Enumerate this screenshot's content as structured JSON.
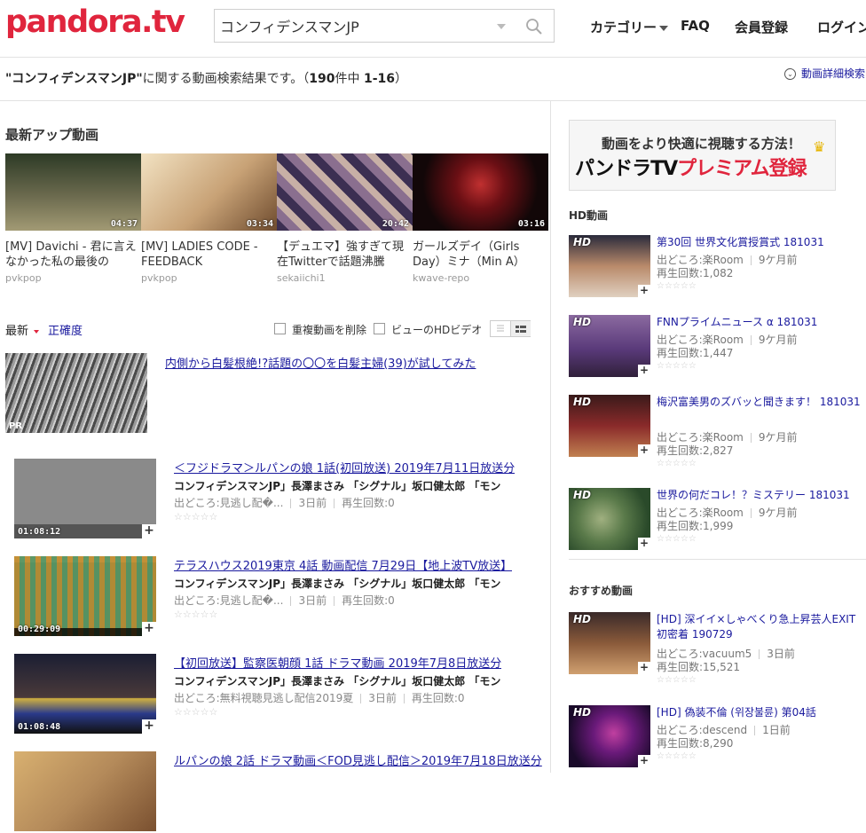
{
  "header": {
    "logo": "pandora.tv",
    "search_value": "コンフィデンスマンJP",
    "nav": [
      "カテゴリー",
      "FAQ",
      "会員登録",
      "ログイン"
    ]
  },
  "result_bar": {
    "query": "\"コンフィデンスマンJP\"",
    "text_mid": "に関する動画検索結果です。（",
    "total": "190",
    "text_unit": "件中 ",
    "range": "1-16",
    "text_end": "）",
    "advanced_search": "動画詳細検索"
  },
  "latest": {
    "title": "最新アップ動画",
    "items": [
      {
        "title": "[MV] Davichi - 君に言えなかった私の最後の",
        "channel": "pvkpop",
        "duration": "04:37",
        "colors": [
          "#2d3a26",
          "#6b6a4e",
          "#a29a74"
        ]
      },
      {
        "title": "[MV] LADIES CODE - FEEDBACK",
        "channel": "pvkpop",
        "duration": "03:34",
        "colors": [
          "#e9d6b5",
          "#c8a276",
          "#6e4b2e"
        ]
      },
      {
        "title": "【デュエマ】強すぎて現在Twitterで話題沸騰",
        "channel": "sekaiichi1",
        "duration": "20:42",
        "colors": [
          "#3c2f52",
          "#8a6f8f",
          "#c8b0a6"
        ]
      },
      {
        "title": "ガールズデイ（Girls Day）ミナ（Min A）",
        "channel": "kwave-repo",
        "duration": "03:16",
        "colors": [
          "#120708",
          "#6b0f14",
          "#c03030"
        ]
      }
    ]
  },
  "sort": {
    "latest": "最新",
    "accuracy": "正確度",
    "remove_dupes": "重複動画を削除",
    "hd_view": "ビューのHDビデオ"
  },
  "pr": {
    "title": "内側から白髪根絶!?話題の〇〇を白髪主婦(39)が試してみた",
    "tag": "PR"
  },
  "results": [
    {
      "title": "＜フジドラマ＞ルパンの娘 1話(初回放送) 2019年7月11日放送分",
      "desc": "コンフィデンスマンJP」長澤まさみ 「シグナル」坂口健太郎 「モン",
      "source": "出どころ:見逃し配�...",
      "age": "3日前",
      "views": "再生回数:0",
      "duration": "01:08:12",
      "colors": [
        "#8a8a8a",
        "#8a8a8a",
        "#8a8a8a"
      ]
    },
    {
      "title": "テラスハウス2019東京 4話 動画配信 7月29日【地上波TV放送】",
      "desc": "コンフィデンスマンJP」長澤まさみ 「シグナル」坂口健太郎 「モン",
      "source": "出どころ:見逃し配�...",
      "age": "3日前",
      "views": "再生回数:0",
      "duration": "00:29:09",
      "colors": [
        "#cfe5e8",
        "#d99a3a",
        "#6aa36c"
      ]
    },
    {
      "title": "【初回放送】監察医朝顔 1話 ドラマ動画 2019年7月8日放送分",
      "desc": "コンフィデンスマンJP」長澤まさみ 「シグナル」坂口健太郎 「モン",
      "source": "出どころ:無料視聴見逃し配信2019夏",
      "age": "3日前",
      "views": "再生回数:0",
      "duration": "01:08:48",
      "colors": [
        "#1b1e33",
        "#4a3a3a",
        "#d0b040"
      ]
    },
    {
      "title": "ルパンの娘 2話 ドラマ動画＜FOD見逃し配信＞2019年7月18日放送分",
      "desc": "",
      "source": "",
      "age": "",
      "views": "",
      "duration": "",
      "colors": [
        "#b48a5a",
        "#7a5030",
        "#d8b070"
      ]
    }
  ],
  "sidebar": {
    "premium_sub": "動画をより快適に視聴する方法！",
    "premium_main_a": "パンドラTV",
    "premium_main_b": "プレミアム登録",
    "hd_title": "HD動画",
    "hd_items": [
      {
        "title": "第30回 世界文化賞授賞式 181031",
        "source": "出どころ:楽Room",
        "age": "9ケ月前",
        "views": "再生回数:1,082",
        "badge": "HD",
        "colors": [
          "#2a2b3c",
          "#b98a6a",
          "#e0d0c0"
        ]
      },
      {
        "title": "FNNプライムニュース α 181031",
        "source": "出どころ:楽Room",
        "age": "9ケ月前",
        "views": "再生回数:1,447",
        "badge": "HD",
        "colors": [
          "#5a3a7a",
          "#8b6aa0",
          "#30203a"
        ]
      },
      {
        "title": "梅沢富美男のズバッと聞きます！ 181031",
        "source": "出どころ:楽Room",
        "age": "9ケ月前",
        "views": "再生回数:2,827",
        "badge": "HD",
        "colors": [
          "#3a1a1a",
          "#8a2a2a",
          "#c08050"
        ]
      },
      {
        "title": "世界の何だコレ！？ミステリー 181031",
        "source": "出どころ:楽Room",
        "age": "9ケ月前",
        "views": "再生回数:1,999",
        "badge": "HD",
        "colors": [
          "#2a4a2a",
          "#5a7a4a",
          "#a0b080"
        ]
      }
    ],
    "rec_title": "おすすめ動画",
    "rec_items": [
      {
        "title": "[HD] 深イイ×しゃべくり急上昇芸人EXIT初密着 190729",
        "source": "出どころ:vacuum5",
        "age": "3日前",
        "views": "再生回数:15,521",
        "badge": "HD",
        "colors": [
          "#3a2a2a",
          "#8a5a3a",
          "#d0a070"
        ]
      },
      {
        "title": "[HD] 偽装不倫 (위장불륜) 第04話",
        "source": "出どころ:descend",
        "age": "1日前",
        "views": "再生回数:8,290",
        "badge": "HD",
        "colors": [
          "#1a0a2a",
          "#6a1a7a",
          "#c040a0"
        ]
      }
    ]
  }
}
